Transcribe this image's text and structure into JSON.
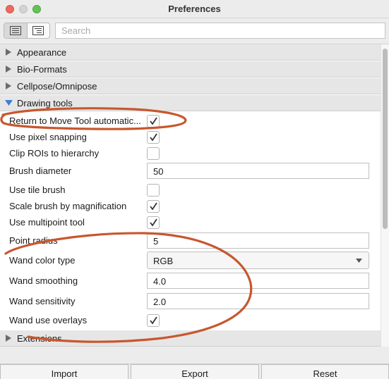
{
  "window": {
    "title": "Preferences"
  },
  "search": {
    "placeholder": "Search"
  },
  "sections": [
    {
      "label": "Appearance",
      "expanded": false
    },
    {
      "label": "Bio-Formats",
      "expanded": false
    },
    {
      "label": "Cellpose/Omnipose",
      "expanded": false
    },
    {
      "label": "Drawing tools",
      "expanded": true
    },
    {
      "label": "Extensions",
      "expanded": false
    }
  ],
  "drawing_tools": {
    "return_to_move": {
      "label": "Return to Move Tool automatic...",
      "checked": true
    },
    "pixel_snapping": {
      "label": "Use pixel snapping",
      "checked": true
    },
    "clip_rois": {
      "label": "Clip ROIs to hierarchy",
      "checked": false
    },
    "brush_diameter": {
      "label": "Brush diameter",
      "value": "50"
    },
    "tile_brush": {
      "label": "Use tile brush",
      "checked": false
    },
    "scale_brush": {
      "label": "Scale brush by magnification",
      "checked": true
    },
    "multipoint": {
      "label": "Use multipoint tool",
      "checked": true
    },
    "point_radius": {
      "label": "Point radius",
      "value": "5"
    },
    "wand_color_type": {
      "label": "Wand color type",
      "value": "RGB"
    },
    "wand_smoothing": {
      "label": "Wand smoothing",
      "value": "4.0"
    },
    "wand_sensitivity": {
      "label": "Wand sensitivity",
      "value": "2.0"
    },
    "wand_overlays": {
      "label": "Wand use overlays",
      "checked": true
    }
  },
  "buttons": {
    "import": "Import",
    "export": "Export",
    "reset": "Reset"
  },
  "colors": {
    "annotation": "#c8572f",
    "expanded_arrow": "#3b7fd6"
  },
  "icons": [
    "list-view-icon",
    "tree-view-icon",
    "checkmark-icon",
    "disclosure-arrow-icon",
    "chevron-down-icon"
  ]
}
